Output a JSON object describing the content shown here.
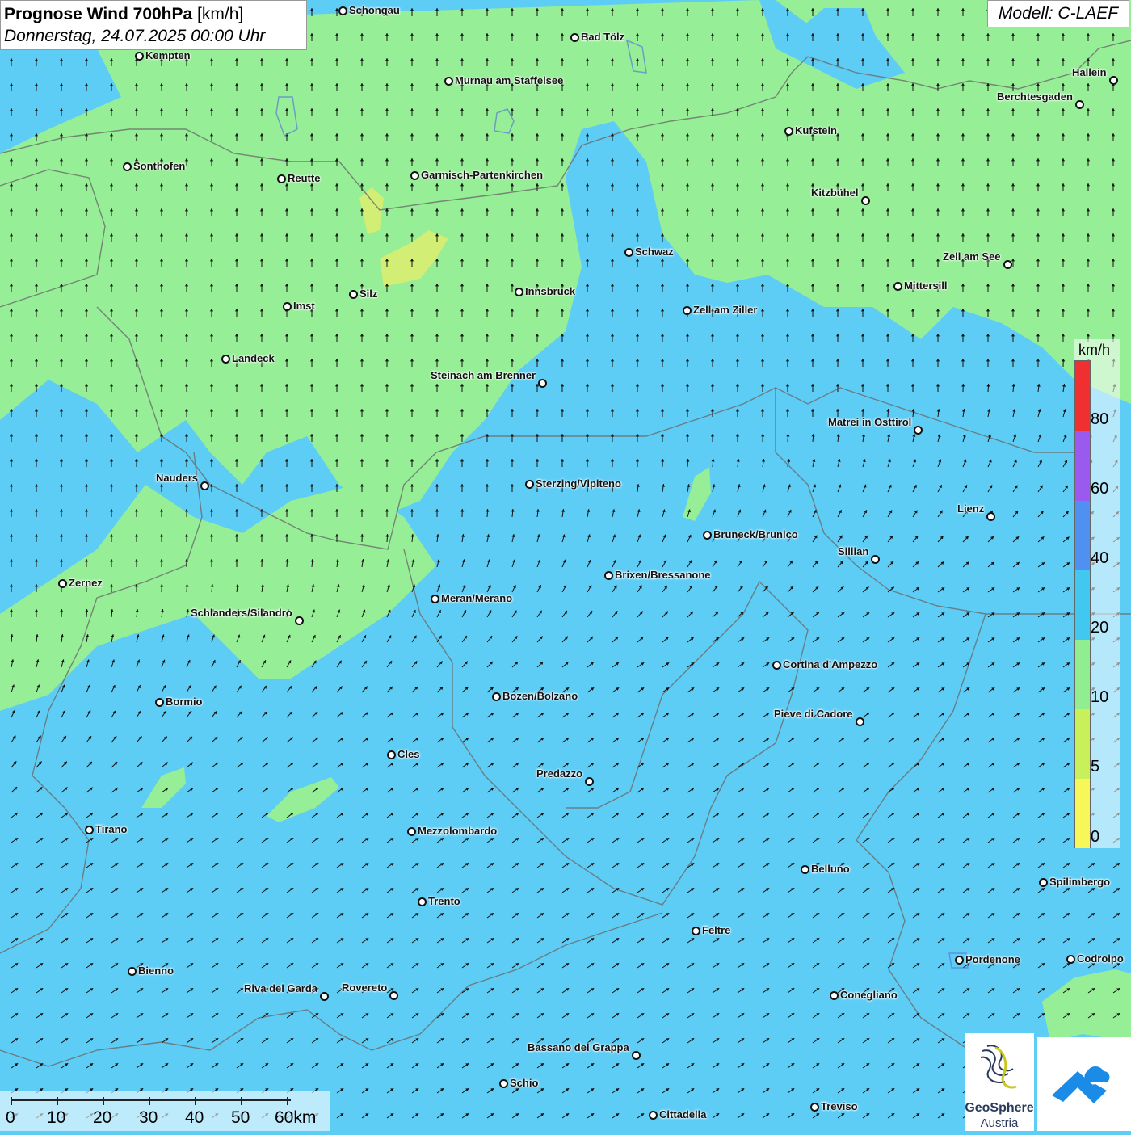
{
  "header": {
    "title_bold": "Prognose Wind 700hPa",
    "title_unit": "[km/h]",
    "datetime": "Donnerstag, 24.07.2025 00:00 Uhr",
    "model": "Modell: C-LAEF"
  },
  "legend": {
    "unit": "km/h",
    "ticks": [
      "0",
      "5",
      "10",
      "20",
      "40",
      "60",
      "80"
    ],
    "colors": [
      "#f7f75a",
      "#c8f05a",
      "#90ee90",
      "#40c8f0",
      "#5090f0",
      "#9a5af0",
      "#f03030"
    ]
  },
  "scale_bar": {
    "labels": [
      "0",
      "10",
      "20",
      "30",
      "40",
      "50",
      "60km"
    ]
  },
  "logos": {
    "geosphere_line1": "GeoSphere",
    "geosphere_line2": "Austria"
  },
  "colors": {
    "wind_10_20": "#96ee96",
    "wind_20_40": "#5ecdf5",
    "wind_5_10": "#d2ee74"
  },
  "cities": [
    {
      "name": "Schongau"
    },
    {
      "name": "Bad Tölz"
    },
    {
      "name": "Kempten"
    },
    {
      "name": "Murnau am Staffelsee"
    },
    {
      "name": "Hallein"
    },
    {
      "name": "Berchtesgaden"
    },
    {
      "name": "Kufstein"
    },
    {
      "name": "Sonthofen"
    },
    {
      "name": "Reutte"
    },
    {
      "name": "Garmisch-Partenkirchen"
    },
    {
      "name": "Kitzbühel"
    },
    {
      "name": "Schwaz"
    },
    {
      "name": "Zell am See"
    },
    {
      "name": "Mittersill"
    },
    {
      "name": "Silz"
    },
    {
      "name": "Innsbruck"
    },
    {
      "name": "Imst"
    },
    {
      "name": "Zell am Ziller"
    },
    {
      "name": "Landeck"
    },
    {
      "name": "Steinach am Brenner"
    },
    {
      "name": "Matrei in Osttirol"
    },
    {
      "name": "Nauders"
    },
    {
      "name": "Sterzing/Vipiteno"
    },
    {
      "name": "Lienz"
    },
    {
      "name": "Bruneck/Brunico"
    },
    {
      "name": "Sillian"
    },
    {
      "name": "Zernez"
    },
    {
      "name": "Brixen/Bressanone"
    },
    {
      "name": "Meran/Merano"
    },
    {
      "name": "Schlanders/Silandro"
    },
    {
      "name": "Cortina d'Ampezzo"
    },
    {
      "name": "Bozen/Bolzano"
    },
    {
      "name": "Bormio"
    },
    {
      "name": "Pieve di Cadore"
    },
    {
      "name": "Cles"
    },
    {
      "name": "Predazzo"
    },
    {
      "name": "Tirano"
    },
    {
      "name": "Mezzolombardo"
    },
    {
      "name": "Belluno"
    },
    {
      "name": "Spilimbergo"
    },
    {
      "name": "Trento"
    },
    {
      "name": "Feltre"
    },
    {
      "name": "Pordenone"
    },
    {
      "name": "Codroipo"
    },
    {
      "name": "Bienno"
    },
    {
      "name": "Riva del Garda"
    },
    {
      "name": "Rovereto"
    },
    {
      "name": "Conegliano"
    },
    {
      "name": "Bassano del Grappa"
    },
    {
      "name": "Schio"
    },
    {
      "name": "Treviso"
    },
    {
      "name": "Cittadella"
    }
  ]
}
